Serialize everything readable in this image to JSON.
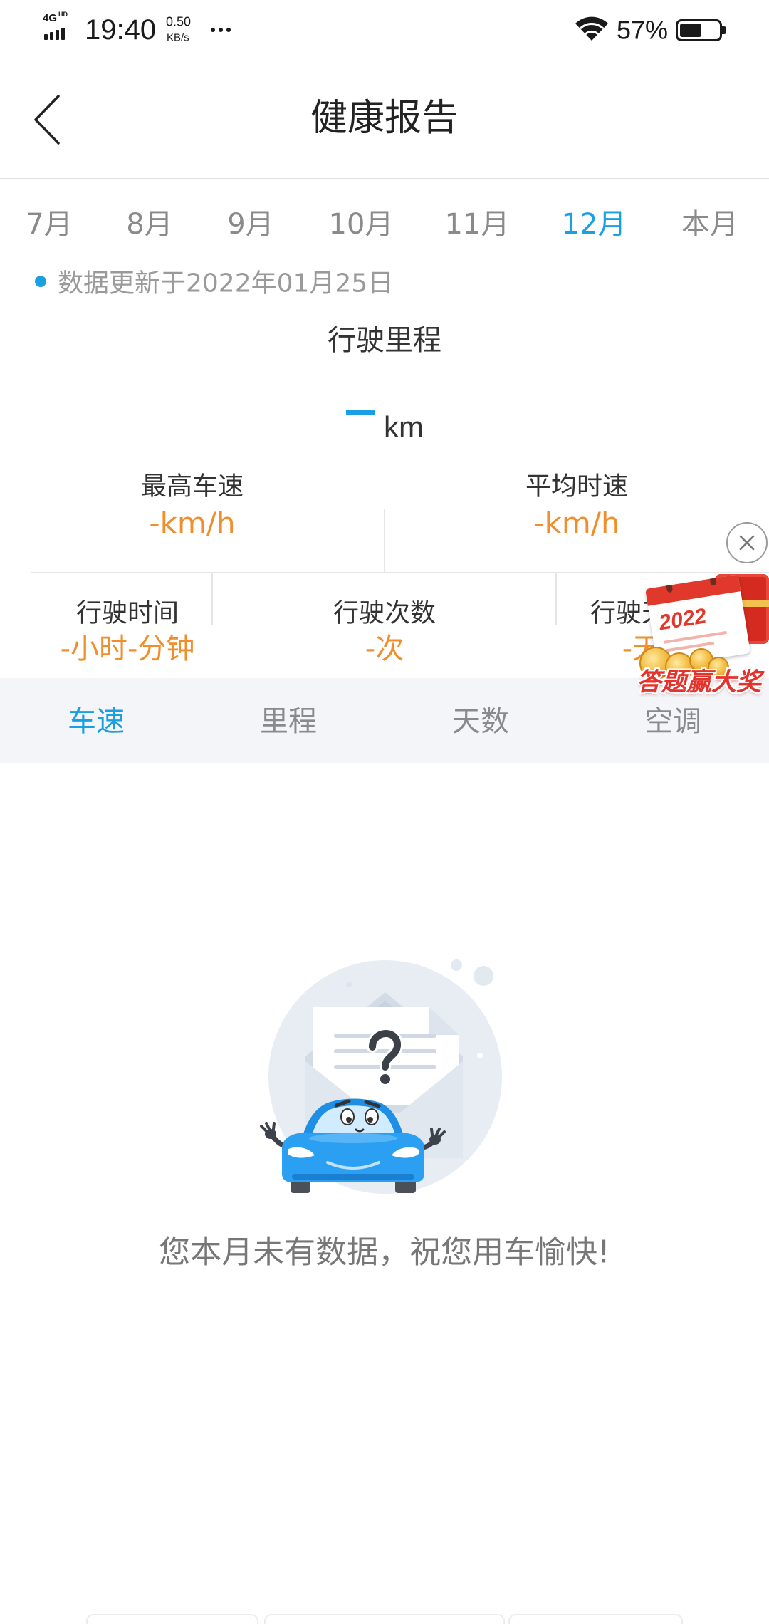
{
  "status_bar": {
    "network": "4G",
    "network_sub": "HD",
    "time": "19:40",
    "net_speed": "0.50",
    "net_speed_unit": "KB/s",
    "battery_text": "57%",
    "battery_level": 0.57,
    "icons": {
      "signal": "signal-icon",
      "more": "more-dots-icon",
      "wifi": "wifi-icon",
      "battery": "battery-icon"
    }
  },
  "header": {
    "title": "健康报告",
    "icons": {
      "back": "back-arrow-icon"
    }
  },
  "month_tabs": {
    "active_index": 5,
    "items": [
      {
        "label": "7月"
      },
      {
        "label": "8月"
      },
      {
        "label": "9月"
      },
      {
        "label": "10月"
      },
      {
        "label": "11月"
      },
      {
        "label": "12月"
      },
      {
        "label": "本月"
      }
    ]
  },
  "update_note": {
    "text": "数据更新于2022年01月25日"
  },
  "mileage": {
    "label": "行驶里程",
    "unit": "km"
  },
  "stats_primary": [
    {
      "label": "最高车速",
      "value": "-km/h"
    },
    {
      "label": "平均时速",
      "value": "-km/h"
    }
  ],
  "stats_secondary": [
    {
      "label": "行驶时间",
      "value": "-小时-分钟"
    },
    {
      "label": "行驶次数",
      "value": "-次"
    },
    {
      "label": "行驶天数",
      "value": "-天"
    }
  ],
  "detail_tabs": {
    "active_index": 0,
    "items": [
      {
        "label": "车速"
      },
      {
        "label": "里程"
      },
      {
        "label": "天数"
      },
      {
        "label": "空调"
      }
    ]
  },
  "promo": {
    "calendar_text": "2022",
    "banner_text": "答题赢大奖",
    "icons": {
      "close": "close-icon"
    }
  },
  "empty_state": {
    "message": "您本月未有数据，祝您用车愉快!"
  },
  "colors": {
    "accent": "#1a9fe3",
    "value": "#ef8e2b",
    "tab_bar_bg": "#f3f5f8",
    "promo_red": "#e5322b"
  }
}
